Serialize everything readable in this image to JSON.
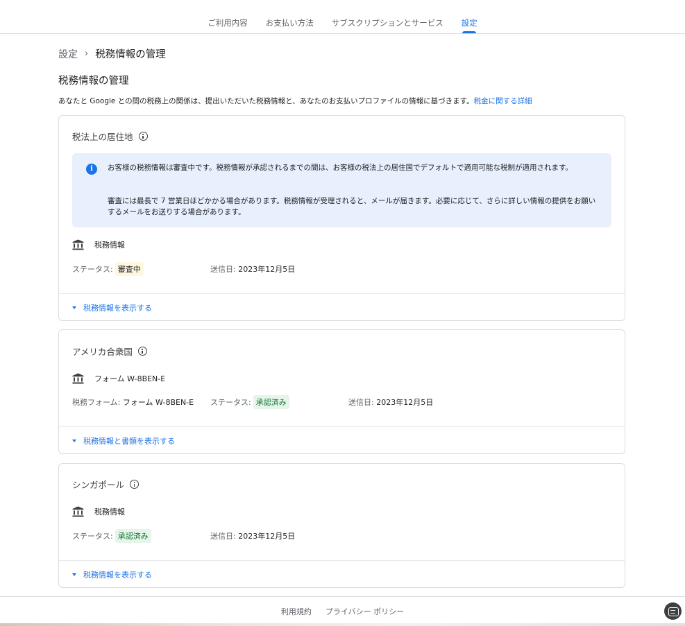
{
  "nav": {
    "tabs": [
      {
        "label": "ご利用内容"
      },
      {
        "label": "お支払い方法"
      },
      {
        "label": "サブスクリプションとサービス"
      },
      {
        "label": "設定"
      }
    ],
    "active_index": 3
  },
  "breadcrumb": {
    "root": "設定",
    "separator": "›",
    "current": "税務情報の管理"
  },
  "page": {
    "title": "税務情報の管理",
    "intro": "あなたと Google との間の税務上の関係は、提出いただいた税務情報と、あなたのお支払いプロファイルの情報に基づきます。",
    "intro_link": "税金に関する詳細"
  },
  "cards": {
    "residence": {
      "title": "税法上の居住地",
      "notice_p1": "お客様の税務情報は審査中です。税務情報が承認されるまでの間は、お客様の税法上の居住国でデフォルトで適用可能な税制が適用されます。",
      "notice_p2": "審査には最長で 7 営業日ほどかかる場合があります。税務情報が受理されると、メールが届きます。必要に応じて、さらに詳しい情報の提供をお願いするメールをお送りする場合があります。",
      "doc_label": "税務情報",
      "status_label": "ステータス:",
      "status_value": "審査中",
      "sent_label": "送信日:",
      "sent_value": "2023年12月5日",
      "expand_label": "税務情報を表示する"
    },
    "us": {
      "title": "アメリカ合衆国",
      "doc_label": "フォーム W-8BEN-E",
      "form_label": "税務フォーム:",
      "form_value": "フォーム W-8BEN-E",
      "status_label": "ステータス:",
      "status_value": "承認済み",
      "sent_label": "送信日:",
      "sent_value": "2023年12月5日",
      "expand_label": "税務情報と書類を表示する"
    },
    "singapore": {
      "title": "シンガポール",
      "doc_label": "税務情報",
      "status_label": "ステータス:",
      "status_value": "承認済み",
      "sent_label": "送信日:",
      "sent_value": "2023年12月5日",
      "expand_label": "税務情報を表示する"
    }
  },
  "footer": {
    "terms": "利用規約",
    "privacy": "プライバシー ポリシー"
  },
  "icons": {
    "bank": "bank-icon",
    "info": "info-icon",
    "feedback": "feedback-icon",
    "expand": "chevron-down-icon"
  },
  "colors": {
    "accent": "#1a73e8",
    "notice_bg": "#e8f0fe",
    "pending_chip": "#fef7e0",
    "approved_chip": "#e6f4ea",
    "approved_text": "#137333"
  }
}
